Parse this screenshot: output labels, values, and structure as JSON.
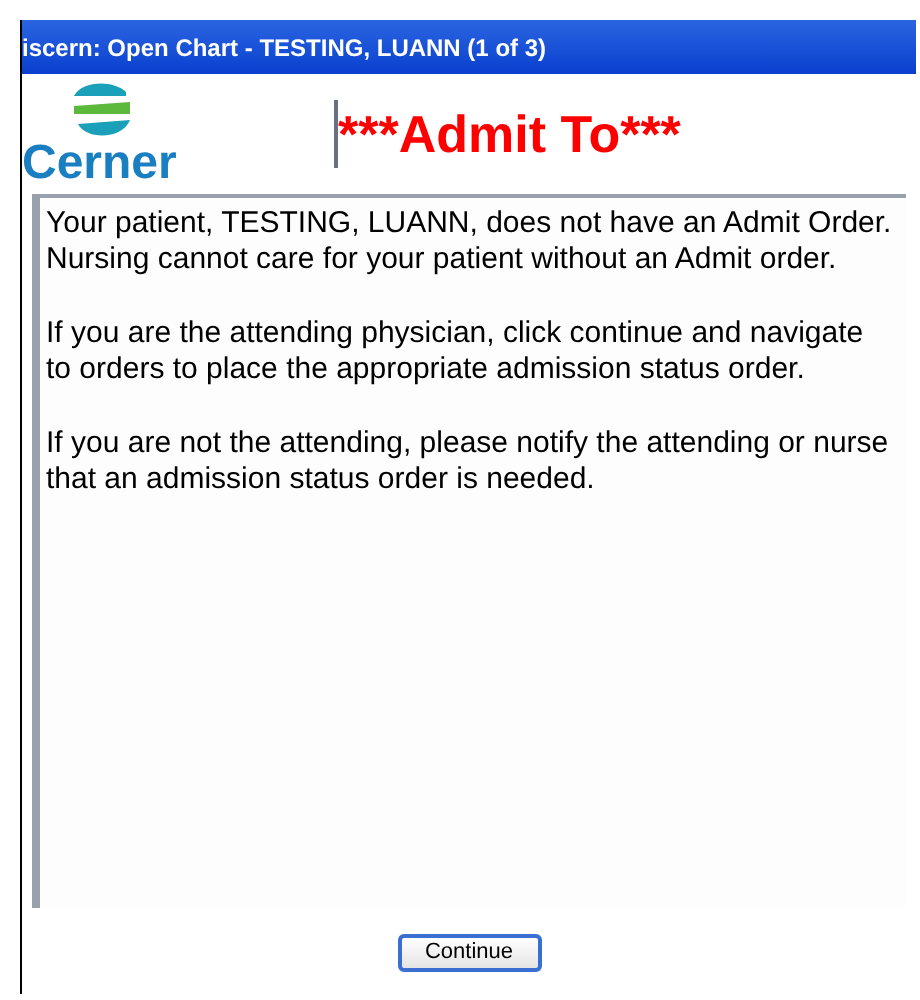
{
  "window": {
    "title": "iscern: Open Chart - TESTING, LUANN (1 of 3)"
  },
  "logo": {
    "text": "Cerner"
  },
  "heading": "***Admit To***",
  "message": [
    "Your patient, TESTING, LUANN, does not have an Admit Order.  Nursing cannot care for your patient without an Admit order.",
    "If you are the attending physician, click continue and navigate to orders to place the appropriate admission status order.",
    "If you are not the attending, please notify the attending or nurse that an admission status order is needed."
  ],
  "buttons": [
    "Continue"
  ]
}
